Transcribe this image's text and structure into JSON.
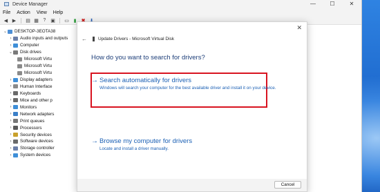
{
  "window": {
    "title": "Device Manager",
    "controls": {
      "minimize": "—",
      "maximize": "☐",
      "close": "✕"
    }
  },
  "menu": [
    "File",
    "Action",
    "View",
    "Help"
  ],
  "tree": {
    "root": "DESKTOP-3EOTA38",
    "items": [
      {
        "label": "Audio inputs and outputs",
        "expanded": false,
        "color": "#6b7fa8"
      },
      {
        "label": "Computer",
        "expanded": false,
        "color": "#3f8fd8"
      },
      {
        "label": "Disk drives",
        "expanded": true,
        "color": "#7a7a7a"
      },
      {
        "label": "Microsoft Virtu",
        "child": true
      },
      {
        "label": "Microsoft Virtu",
        "child": true
      },
      {
        "label": "Microsoft Virtu",
        "child": true
      },
      {
        "label": "Display adapters",
        "expanded": false,
        "color": "#3f8fd8"
      },
      {
        "label": "Human Interface",
        "expanded": false,
        "color": "#8a8a8a"
      },
      {
        "label": "Keyboards",
        "expanded": false,
        "color": "#6a6a6a"
      },
      {
        "label": "Mice and other p",
        "expanded": false,
        "color": "#6a6a6a"
      },
      {
        "label": "Monitors",
        "expanded": false,
        "color": "#3f8fd8"
      },
      {
        "label": "Network adapters",
        "expanded": false,
        "color": "#3a7fc8"
      },
      {
        "label": "Print queues",
        "expanded": false,
        "color": "#777"
      },
      {
        "label": "Processors",
        "expanded": false,
        "color": "#5a5a5a"
      },
      {
        "label": "Security devices",
        "expanded": false,
        "color": "#c9a12c"
      },
      {
        "label": "Software devices",
        "expanded": false,
        "color": "#6a6a6a"
      },
      {
        "label": "Storage controller",
        "expanded": false,
        "color": "#6b7fa8"
      },
      {
        "label": "System devices",
        "expanded": false,
        "color": "#3f8fd8"
      }
    ]
  },
  "dialog": {
    "close": "✕",
    "back": "←",
    "title": "Update Drivers - Microsoft Virtual Disk",
    "question": "How do you want to search for drivers?",
    "option_auto": {
      "arrow": "→",
      "title": "Search automatically for drivers",
      "desc": "Windows will search your computer for the best available driver and install it on your device."
    },
    "option_browse": {
      "arrow": "→",
      "title": "Browse my computer for drivers",
      "desc": "Locate and install a driver manually."
    },
    "cancel": "Cancel"
  },
  "colors": {
    "highlight": "#d8121f",
    "link": "#1a5fb4"
  }
}
